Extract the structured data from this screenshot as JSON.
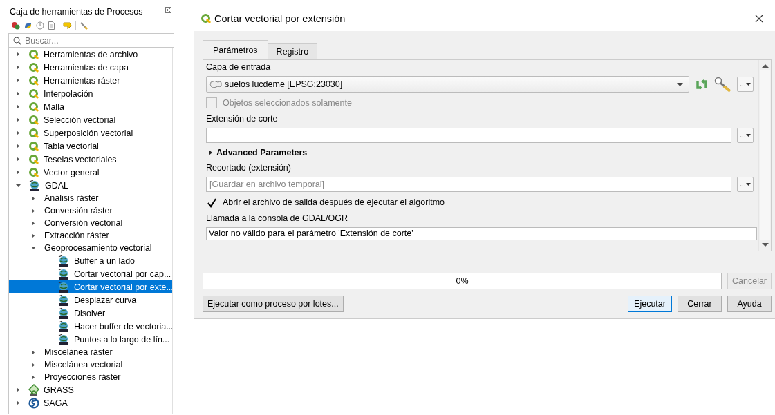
{
  "toolbox": {
    "title": "Caja de herramientas de Procesos",
    "search": {
      "placeholder": "Buscar..."
    },
    "tree": [
      {
        "label": "Herramientas de archivo",
        "kind": "qgis",
        "expanded": false,
        "selected": false
      },
      {
        "label": "Herramientas de capa",
        "kind": "qgis",
        "expanded": false,
        "selected": false
      },
      {
        "label": "Herramientas ráster",
        "kind": "qgis",
        "expanded": false,
        "selected": false
      },
      {
        "label": "Interpolación",
        "kind": "qgis",
        "expanded": false,
        "selected": false
      },
      {
        "label": "Malla",
        "kind": "qgis",
        "expanded": false,
        "selected": false
      },
      {
        "label": "Selección vectorial",
        "kind": "qgis",
        "expanded": false,
        "selected": false
      },
      {
        "label": "Superposición vectorial",
        "kind": "qgis",
        "expanded": false,
        "selected": false
      },
      {
        "label": "Tabla vectorial",
        "kind": "qgis",
        "expanded": false,
        "selected": false
      },
      {
        "label": "Teselas vectoriales",
        "kind": "qgis",
        "expanded": false,
        "selected": false
      },
      {
        "label": "Vector general",
        "kind": "qgis",
        "expanded": false,
        "selected": false
      },
      {
        "label": "GDAL",
        "kind": "gdal",
        "expanded": true,
        "selected": false,
        "children": [
          {
            "label": "Análisis ráster",
            "kind": "group",
            "expanded": false,
            "selected": false
          },
          {
            "label": "Conversión ráster",
            "kind": "group",
            "expanded": false,
            "selected": false
          },
          {
            "label": "Conversión vectorial",
            "kind": "group",
            "expanded": false,
            "selected": false
          },
          {
            "label": "Extracción ráster",
            "kind": "group",
            "expanded": false,
            "selected": false
          },
          {
            "label": "Geoprocesamiento vectorial",
            "kind": "group",
            "expanded": true,
            "selected": false,
            "children": [
              {
                "label": "Buffer a un lado",
                "kind": "algorithm",
                "selected": false
              },
              {
                "label": "Cortar vectorial por cap...",
                "kind": "algorithm",
                "selected": false
              },
              {
                "label": "Cortar vectorial por exte...",
                "kind": "algorithm",
                "selected": true
              },
              {
                "label": "Desplazar curva",
                "kind": "algorithm",
                "selected": false
              },
              {
                "label": "Disolver",
                "kind": "algorithm",
                "selected": false
              },
              {
                "label": "Hacer buffer de vectoria...",
                "kind": "algorithm",
                "selected": false
              },
              {
                "label": "Puntos a lo largo de lín...",
                "kind": "algorithm",
                "selected": false
              }
            ]
          },
          {
            "label": "Miscelánea ráster",
            "kind": "group",
            "expanded": false,
            "selected": false
          },
          {
            "label": "Miscelánea vectorial",
            "kind": "group",
            "expanded": false,
            "selected": false
          },
          {
            "label": "Proyecciones ráster",
            "kind": "group",
            "expanded": false,
            "selected": false
          }
        ]
      },
      {
        "label": "GRASS",
        "kind": "grass",
        "expanded": false,
        "selected": false
      },
      {
        "label": "SAGA",
        "kind": "saga",
        "expanded": false,
        "selected": false
      }
    ]
  },
  "dialog": {
    "title": "Cortar vectorial por extensión",
    "tabs": [
      {
        "label": "Parámetros",
        "selected": true
      },
      {
        "label": "Registro",
        "selected": false
      }
    ],
    "params": [
      {
        "kind": "layer",
        "label": "Capa de entrada",
        "value": "suelos lucdeme [EPSG:23030]",
        "more": "..."
      },
      {
        "kind": "checkbox",
        "label": "Objetos seleccionados solamente",
        "checked": false,
        "disabled": true
      },
      {
        "kind": "extent",
        "label": "Extensión de corte",
        "more": "..."
      },
      {
        "kind": "section",
        "label": "Advanced Parameters",
        "expanded": false
      },
      {
        "kind": "output",
        "label": "Recortado (extensión)",
        "placeholder": "[Guardar en archivo temporal]",
        "more": "..."
      },
      {
        "kind": "checkbox",
        "label": "Abrir el archivo de salida después de ejecutar el algoritmo",
        "checked": true,
        "disabled": false
      },
      {
        "kind": "console",
        "label": "Llamada a la consola de GDAL/OGR",
        "value": "Valor no válido para el parámetro 'Extensión de corte'"
      }
    ],
    "progress": {
      "level": 0,
      "reading": "0%"
    },
    "cancel_button": {
      "label": "Cancelar",
      "disabled": true
    },
    "batch_button": {
      "label": "Ejecutar como proceso por lotes..."
    },
    "buttons": [
      {
        "label": "Ejecutar",
        "focused": true
      },
      {
        "label": "Cerrar",
        "focused": false
      },
      {
        "label": "Ayuda",
        "focused": false
      }
    ]
  }
}
